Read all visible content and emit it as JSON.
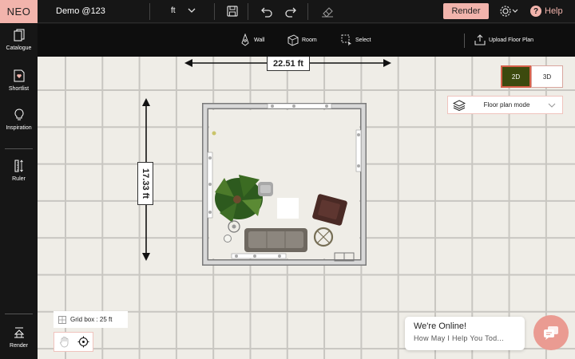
{
  "app": {
    "logo": "NEO",
    "project_name": "Demo @123"
  },
  "topbar": {
    "unit": "ft",
    "icons": [
      "save-icon",
      "undo-icon",
      "redo-icon",
      "eraser-icon",
      "gear-icon"
    ],
    "render_label": "Render",
    "help_label": "Help",
    "help_glyph": "?"
  },
  "toolbar": {
    "wall_label": "Wall",
    "room_label": "Room",
    "select_label": "Select",
    "upload_label": "Upload Floor Plan"
  },
  "sidebar": {
    "items": [
      {
        "label": "Catalogue",
        "icon": "catalogue-icon"
      },
      {
        "label": "Shortlist",
        "icon": "shortlist-icon"
      },
      {
        "label": "Inspiration",
        "icon": "lightbulb-icon"
      },
      {
        "label": "Ruler",
        "icon": "ruler-icon"
      }
    ],
    "bottom": {
      "label": "Render",
      "icon": "render-icon"
    }
  },
  "canvas": {
    "width_dimension": "22.51 ft",
    "height_dimension": "17.33 ft",
    "view": {
      "options": [
        "2D",
        "3D"
      ],
      "selected": "2D"
    },
    "mode": {
      "label": "Floor plan mode"
    },
    "grid_label": "Grid box : 25 ft"
  },
  "chat": {
    "title": "We're Online!",
    "subtitle": "How May I Help You Tod..."
  },
  "colors": {
    "accent": "#f2b4ac",
    "active_view": "#3c4a0e",
    "active_border": "#d7604a",
    "chat_button": "#ea9b92",
    "canvas_bg": "#efede7",
    "grid_line": "#c8c6c1"
  }
}
